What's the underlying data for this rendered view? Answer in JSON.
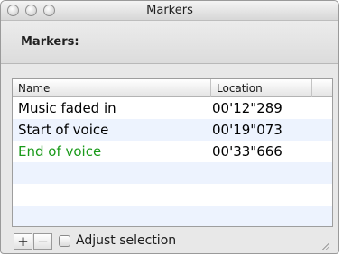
{
  "window": {
    "title": "Markers",
    "buttons": [
      "close",
      "minimize",
      "zoom"
    ]
  },
  "header": {
    "label": "Markers:"
  },
  "table": {
    "columns": {
      "name": "Name",
      "location": "Location"
    },
    "rows": [
      {
        "name": "Music faded in",
        "location": "00'12\"289",
        "color": "#000000"
      },
      {
        "name": "Start of voice",
        "location": "00'19\"073",
        "color": "#000000"
      },
      {
        "name": "End of voice",
        "location": "00'33\"666",
        "color": "#1a9a1a"
      }
    ]
  },
  "footer": {
    "add_label": "+",
    "remove_label": "−",
    "adjust_selection_label": "Adjust selection",
    "adjust_selection_checked": false
  }
}
